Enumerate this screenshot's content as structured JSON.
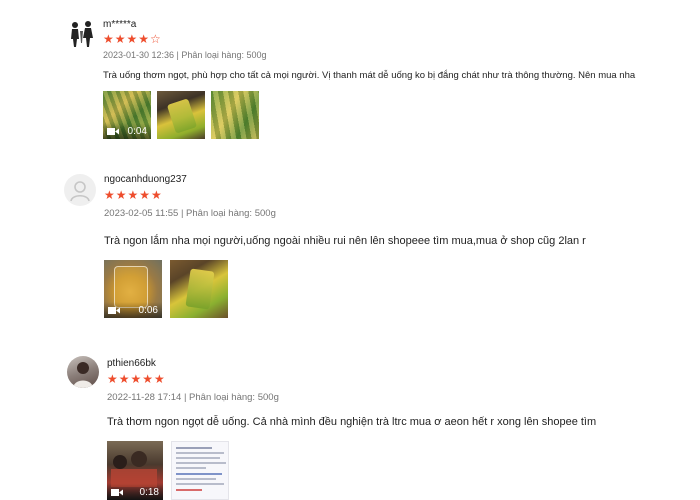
{
  "reviews": [
    {
      "username": "m*****a",
      "rating_stars": "★★★★☆",
      "rating": 4,
      "meta": "2023-01-30 12:36 | Phân loại hàng: 500g",
      "content": "Trà uống thơm ngọt, phù hợp cho tất cả mọi người. Vị thanh mát dễ uống ko bị đắng chát như trà thông thường. Nên mua nha",
      "video_duration": "0:04"
    },
    {
      "username": "ngocanhduong237",
      "rating_stars": "★★★★★",
      "rating": 5,
      "meta": "2023-02-05 11:55 | Phân loại hàng: 500g",
      "content": "Trà ngon lắm nha mọi người,uống ngoài nhiều rui nên lên shopeee tìm mua,mua ở shop cũg 2lan r",
      "video_duration": "0:06"
    },
    {
      "username": "pthien66bk",
      "rating_stars": "★★★★★",
      "rating": 5,
      "meta": "2022-11-28 17:14 | Phân loại hàng: 500g",
      "content": "Trà thơm ngon ngọt dễ uống. Cả nhà mình đều nghiện trà ltrc mua ơ aeon hết r xong lên shopee tìm",
      "video_duration": "0:18"
    }
  ],
  "colors": {
    "star": "#ee4d2d",
    "meta": "#757575"
  }
}
